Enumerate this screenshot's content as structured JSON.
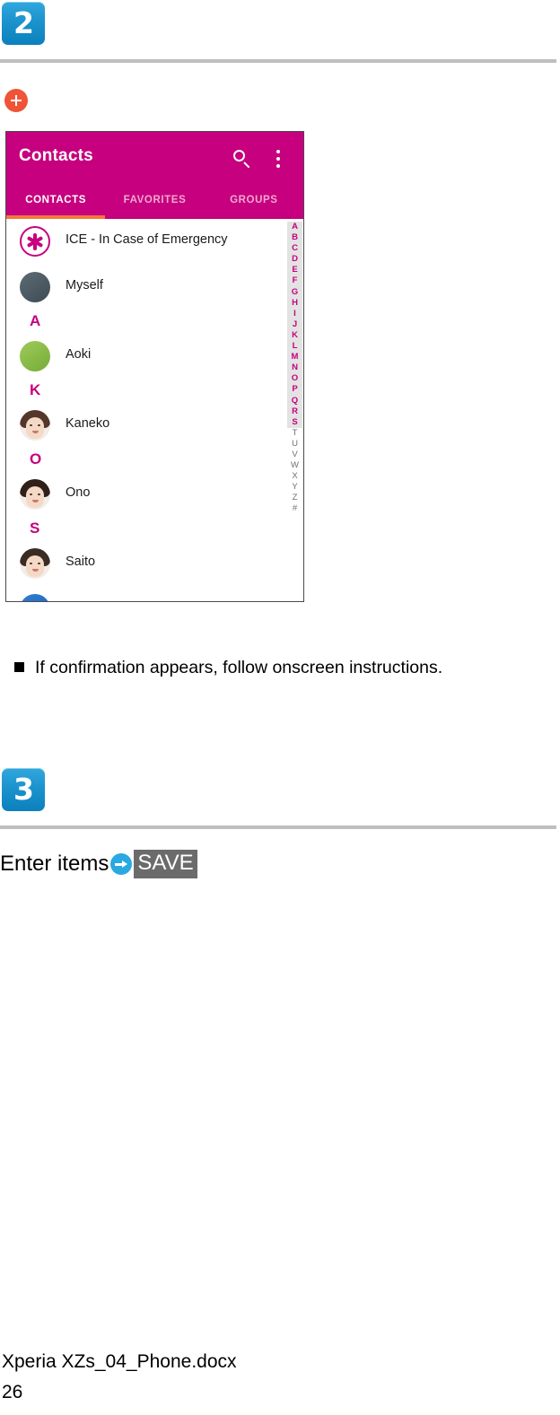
{
  "steps": [
    {
      "number": "2"
    },
    {
      "number": "3"
    }
  ],
  "inline_icon": {
    "name": "add-plus-icon",
    "color": "#ef5436"
  },
  "screenshot": {
    "appbar": {
      "title": "Contacts",
      "search_icon": "search-icon",
      "overflow_icon": "overflow-menu-icon",
      "background": "#c6007e"
    },
    "tabs": [
      {
        "label": "CONTACTS",
        "active": true
      },
      {
        "label": "FAVORITES",
        "active": false
      },
      {
        "label": "GROUPS",
        "active": false
      }
    ],
    "tab_indicator_color": "#f4763a",
    "rows": [
      {
        "type": "contact",
        "name": "ICE - In Case of Emergency",
        "avatar": "ice-asterisk-avatar"
      },
      {
        "type": "contact",
        "name": "Myself",
        "avatar": "slate-avatar"
      },
      {
        "type": "section",
        "letter": "A"
      },
      {
        "type": "contact",
        "name": "Aoki",
        "avatar": "green-avatar"
      },
      {
        "type": "section",
        "letter": "K"
      },
      {
        "type": "contact",
        "name": "Kaneko",
        "avatar": "photo-avatar"
      },
      {
        "type": "section",
        "letter": "O"
      },
      {
        "type": "contact",
        "name": "Ono",
        "avatar": "photo-avatar"
      },
      {
        "type": "section",
        "letter": "S"
      },
      {
        "type": "contact",
        "name": "Saito",
        "avatar": "photo-avatar"
      },
      {
        "type": "contact",
        "name": "",
        "avatar": "blue-avatar"
      }
    ],
    "alpha_index": {
      "active": [
        "A",
        "B",
        "C",
        "D",
        "E",
        "F",
        "G",
        "H",
        "I",
        "J",
        "K",
        "L",
        "M",
        "N",
        "O",
        "P",
        "Q",
        "R",
        "S"
      ],
      "inactive": [
        "T",
        "U",
        "V",
        "W",
        "X",
        "Y",
        "Z",
        "#"
      ],
      "active_color": "#c6007e",
      "inactive_color": "#6f6f6f"
    },
    "fab": {
      "name": "add-contact-fab",
      "icon": "plus-icon",
      "color": "#ef5436",
      "highlight_color": "#f00000"
    }
  },
  "note": {
    "bullet": "square-bullet",
    "text": "If confirmation appears, follow onscreen instructions."
  },
  "instruction": {
    "lead_text": "Enter items",
    "arrow_icon": "arrow-right-circle-icon",
    "chip_label": "SAVE",
    "chip_background": "#6b6b6b"
  },
  "footer": {
    "filename": "Xperia XZs_04_Phone.docx",
    "page_number": "26"
  }
}
